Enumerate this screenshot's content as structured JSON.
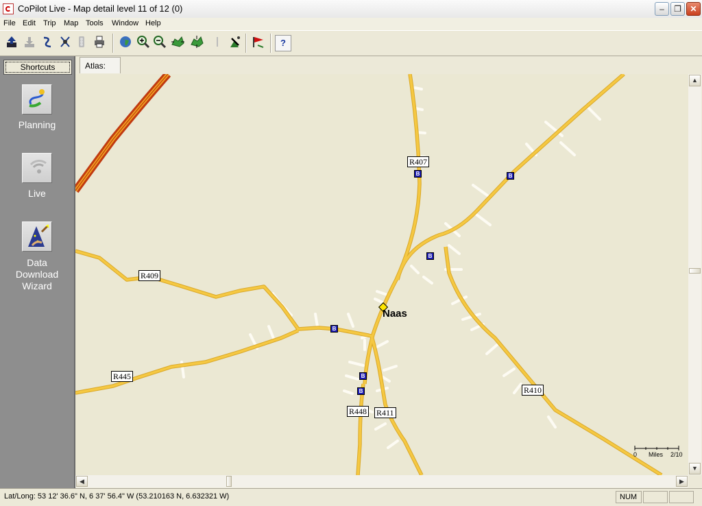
{
  "window": {
    "title": "CoPilot Live - Map detail level 11 of 12 (0)",
    "minimize": "–",
    "restore": "❐",
    "close": "✕"
  },
  "menu": [
    "File",
    "Edit",
    "Trip",
    "Map",
    "Tools",
    "Window",
    "Help"
  ],
  "toolbar": {
    "icons": [
      "upload-icon",
      "download-icon",
      "route-icon",
      "satellite-icon",
      "traffic-icon",
      "print-icon",
      "globe-icon",
      "zoom-in-icon",
      "zoom-out-icon",
      "map-move-icon",
      "map-move-2-icon",
      "separator-icon",
      "gps-antenna-icon",
      "flag-icon",
      "help-icon"
    ],
    "help_label": "?"
  },
  "sidebar": {
    "shortcuts_label": "Shortcuts",
    "items": [
      {
        "label": "Planning",
        "icon": "planning-route-icon"
      },
      {
        "label": "Live",
        "icon": "live-signal-icon"
      },
      {
        "label": "Data Download Wizard",
        "icon": "wizard-icon"
      }
    ]
  },
  "tabs": {
    "atlas_label": "Atlas:"
  },
  "map": {
    "town": "Naas",
    "road_labels": [
      "R407",
      "R409",
      "R445",
      "R448",
      "R411",
      "R410"
    ],
    "bus_glyph": "B",
    "scale": {
      "start": "0",
      "unit": "Miles",
      "end": "2/10"
    },
    "colors": {
      "background": "#ebe8d3",
      "road": "#f5c842",
      "motorway": "#d04010"
    }
  },
  "status": {
    "latlong": "Lat/Long:  53 12' 36.6\" N,    6 37' 56.4\" W (53.210163 N, 6.632321 W)",
    "num": "NUM"
  }
}
